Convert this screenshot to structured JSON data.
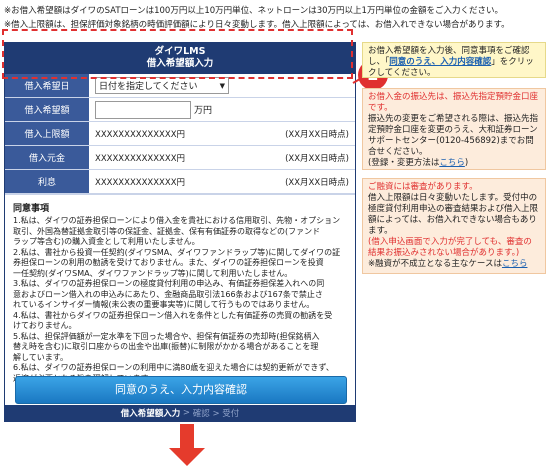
{
  "notes": [
    "※お借入希望額はダイワのSATローンは100万円以上10万円単位、ネットローンは30万円以上1万円単位の金額をご入力ください。",
    "※借入上限額は、担保評価対象銘柄の時価評価額により日々変動します。借入上限額によっては、お借入れできない場合があります。"
  ],
  "form": {
    "brand": "ダイワLMS",
    "title": "借入希望額入力",
    "date_label": "借入希望日",
    "date_select_value": "日付を指定してください",
    "amount_label": "借入希望額",
    "amount_value": "",
    "amount_unit": "万円",
    "limit_label": "借入上限額",
    "limit_value": "XXXXXXXXXXXXXX円",
    "limit_asof": "(XX月XX日時点)",
    "principal_label": "借入元金",
    "principal_value": "XXXXXXXXXXXXXX円",
    "principal_asof": "(XX月XX日時点)",
    "interest_label": "利息",
    "interest_value": "XXXXXXXXXXXXXX円",
    "interest_asof": "(XX月XX日時点)"
  },
  "agreement": {
    "title": "同意事項",
    "body": "1.私は、ダイワの証券担保ローンにより借入金を貴社における信用取引、先物・オプション\n  取引、外国為替証拠金取引等の保証金、証拠金、保有有価証券の取得などの(ファンド\n  ラップ等含む)の購入資金として利用いたしません。\n2.私は、書社から投資一任契約(ダイワSMA、ダイワファンドラップ等)に関してダイワの証\n  券担保ローンの利用の勧誘を受けておりません。また、ダイワの証券担保ローンを投資\n  一任契約(ダイワSMA、ダイワファンドラップ等)に関して利用いたしません。\n3.私は、ダイワの証券担保ローンの極度貸付利用の申込み、有価証券担保差入れへの同\n  意およびローン借入れの申込みにあたり、金融商品取引法166条および167条で禁止さ\n  れているインサイダー情報(未公表の重要事実等)に関して行うものではありません。\n4.私は、書社からダイワの証券担保ローン借入れを条件とした有価証券の売買の勧誘を受\n  けておりません。\n5.私は、担保評価額が一定水準を下回った場合や、担保有価証券の売却時(担保銘柄入\n  替え時を含む)に取引口座からの出金や出庫(振替)に制限がかかる場合があることを理\n  解しています。\n6.私は、ダイワの証券担保ローンの利用中に満80歳を迎えた場合には契約更新ができず、\n  返済が必要となる旨を理解しています。",
    "confirm_button": "同意のうえ、入力内容確認",
    "steps_current": "借入希望額入力",
    "steps_rest": "確認 > 受付"
  },
  "side": {
    "yellow_text_1": "お借入希望額を入力後、同意事項をご確認し、「",
    "yellow_link": "同意のうえ、入力内容確認",
    "yellow_text_2": "」をクリックしてください。",
    "orange_red": "お借入金の振込先は、振込先指定預貯金口座です。",
    "orange_text": "振込先の変更をご希望される際は、振込先指定預貯金口座を変更のうえ、大和証券ローンサポートセンター(0120-456892)までお問合せください。",
    "orange_link_prefix": "(登録・変更方法は",
    "orange_link": "こちら",
    "orange_link_suffix": ")",
    "pink_red_1": "ご融資には審査があります。",
    "pink_text": "借入上限額は日々変動いたします。受付中の極度貸付利用申込の審査結果および借入上限額によっては、お借入れできない場合もあります。",
    "pink_red_2": "(借入申込画面で入力が完了しても、審査の結果お振込みされない場合があります。)",
    "pink_note_prefix": "※融資が不成立となる主なケースは",
    "pink_note_link": "こちら"
  },
  "badge_number": "2",
  "colors": {
    "header_navy": "#1f3b73",
    "label_blue": "#3a5a9a",
    "button_blue": "#1a78c2",
    "accent_red": "#e03030",
    "yellow_panel": "#fff7c8",
    "orange_panel": "#fdecdc"
  }
}
